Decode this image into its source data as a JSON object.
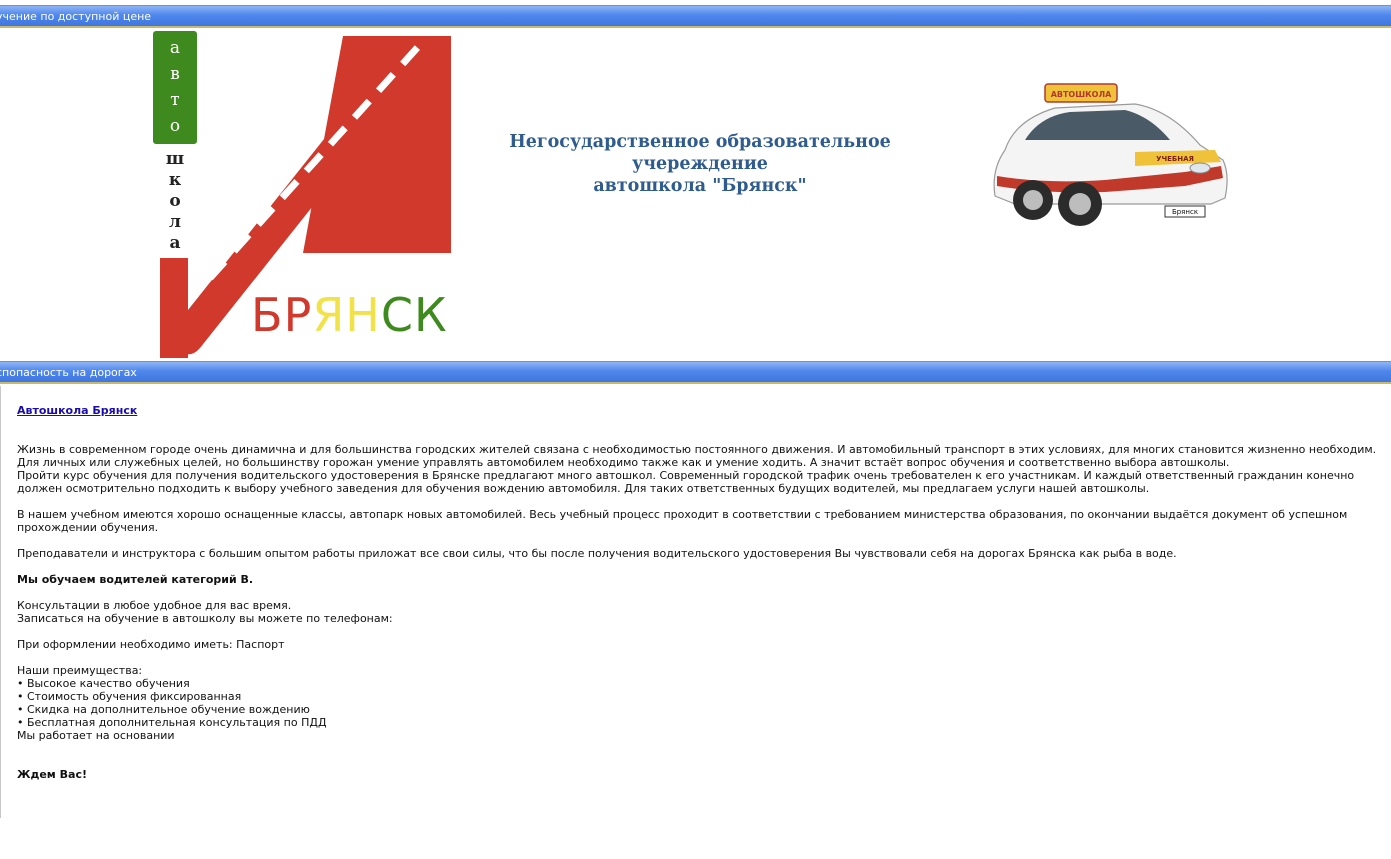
{
  "top_bar": {
    "text": "учение по доступной цене"
  },
  "header": {
    "logo": {
      "vertical_green": [
        "а",
        "в",
        "т",
        "о"
      ],
      "vertical_dark": [
        "ш",
        "к",
        "о",
        "л",
        "а"
      ],
      "city": [
        "Б",
        "Р",
        "Я",
        "Н",
        "С",
        "К"
      ],
      "colors": {
        "red": "#d0392b",
        "green": "#3f8a1e",
        "yellow": "#f2e24a"
      }
    },
    "institution_line1": "Негосударственное образовательное учереждение",
    "institution_line2": "автошкола \"Брянск\"",
    "car_plate": "Брянск",
    "car_roof_sign": "АВТОШКОЛА",
    "car_side_label": "УЧЕБНАЯ"
  },
  "mid_bar": {
    "text": "спопасность на дорогах"
  },
  "content": {
    "title_link": "Автошкола Брянск",
    "p1": "Жизнь в современном городе очень динамична и для большинства городских жителей связана с необходимостью постоянного движения. И автомобильный транспорт в этих условиях, для многих становится жизненно необходим. Для личных или служебных целей, но большинству горожан умение управлять автомобилем необходимо также как и умение ходить. А значит встаёт вопрос обучения и соответственно выбора автошколы.",
    "p2": "Пройти курс обучения для получения водительского удостоверения в Брянске предлагают много автошкол. Современный городской трафик очень требователен к его участникам. И каждый ответственный гражданин конечно должен осмотрительно подходить к выбору учебного заведения для обучения вождению автомобиля. Для таких ответственных будущих водителей, мы предлагаем услуги нашей автошколы.",
    "p3": "В нашем учебном имеются хорошо оснащенные классы, автопарк новых автомобилей. Весь учебный процесс проходит в соответствии с требованием министерства образования, по окончании выдаётся документ об успешном прохождении обучения.",
    "p4": "Преподаватели и инструктора с большим опытом работы приложат все свои силы, что бы после получения водительского удостоверения Вы чувствовали себя на дорогах Брянска как рыба в воде.",
    "categories": "Мы обучаем водителей категорий B.",
    "consult1": "Консультации в любое удобное для вас время.",
    "consult2": "Записаться на обучение в автошколу вы можете по телефонам:",
    "docs": "При оформлении необходимо иметь: Паспорт",
    "adv_title": "Наши преимущества:",
    "advantages": [
      "• Высокое качество обучения",
      "• Стоимость обучения фиксированная",
      "• Скидка на дополнительное обучение вождению",
      "• Бесплатная дополнительная консультация по ПДД"
    ],
    "basis": "Мы работает на основании",
    "closing": "Ждем Вас!"
  }
}
